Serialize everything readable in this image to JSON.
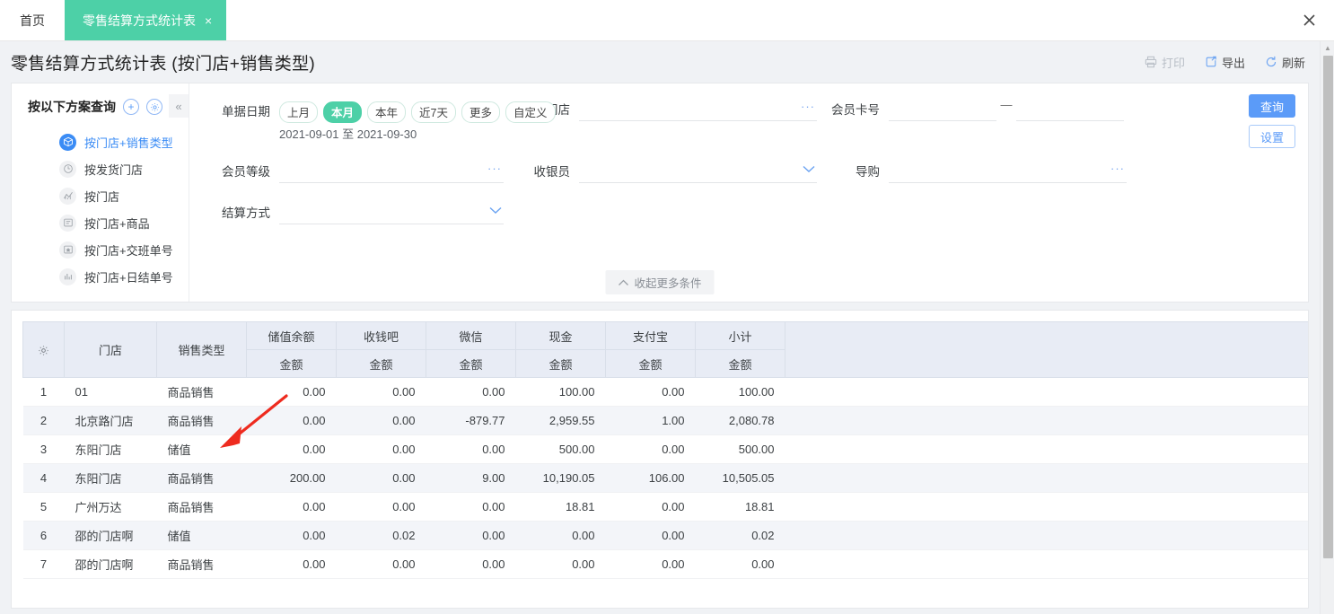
{
  "tabs": {
    "home_label": "首页",
    "active_label": "零售结算方式统计表",
    "close_glyph": "×",
    "window_close_glyph": "✕"
  },
  "header": {
    "title": "零售结算方式统计表 (按门店+销售类型)",
    "actions": [
      {
        "label": "打印",
        "icon": "printer-icon",
        "state": "disabled"
      },
      {
        "label": "导出",
        "icon": "export-icon",
        "state": "enabled"
      },
      {
        "label": "刷新",
        "icon": "refresh-icon",
        "state": "enabled"
      }
    ]
  },
  "scheme": {
    "title": "按以下方案查询",
    "add_glyph": "+",
    "gear_glyph": "⚙",
    "collapse_glyph": "«",
    "items": [
      {
        "label": "按门店+销售类型",
        "icon": "cube-icon",
        "active": true
      },
      {
        "label": "按发货门店",
        "icon": "clock-icon",
        "active": false
      },
      {
        "label": "按门店",
        "icon": "trend-icon",
        "active": false
      },
      {
        "label": "按门店+商品",
        "icon": "list-card-icon",
        "active": false
      },
      {
        "label": "按门店+交班单号",
        "icon": "star-card-icon",
        "active": false
      },
      {
        "label": "按门店+日结单号",
        "icon": "bar-chart-icon",
        "active": false
      }
    ]
  },
  "form": {
    "date": {
      "label": "单据日期",
      "chips": [
        {
          "label": "上月",
          "selected": false
        },
        {
          "label": "本月",
          "selected": true
        },
        {
          "label": "本年",
          "selected": false
        },
        {
          "label": "近7天",
          "selected": false
        },
        {
          "label": "更多",
          "selected": false
        },
        {
          "label": "自定义",
          "selected": false
        }
      ],
      "range_text": "2021-09-01 至 2021-09-30",
      "start": "2021-09-01",
      "end": "2021-09-30"
    },
    "member_level": {
      "label": "会员等级",
      "value": "",
      "suffix": "···"
    },
    "settle_method": {
      "label": "结算方式",
      "value": "",
      "suffix": "chevron-down"
    },
    "ship_store": {
      "label": "发货门店",
      "value": "",
      "suffix": "···"
    },
    "cashier": {
      "label": "收银员",
      "value": "",
      "suffix": "chevron-down"
    },
    "member_card": {
      "label": "会员卡号",
      "from_value": "",
      "to_value": "",
      "separator": "—"
    },
    "guide": {
      "label": "导购",
      "value": "",
      "suffix": "···"
    },
    "buttons": {
      "query": "查询",
      "settings": "设置"
    },
    "collapse_more": {
      "label": "收起更多条件",
      "icon": "chevron-up-icon"
    }
  },
  "table": {
    "settings_icon": "gear-icon",
    "group_headers": [
      "门店",
      "销售类型",
      "储值余额",
      "收钱吧",
      "微信",
      "现金",
      "支付宝",
      "小计"
    ],
    "sub_header_label": "金额",
    "rows": [
      {
        "idx": "1",
        "store": "01",
        "sale_type": "商品销售",
        "stored": "0.00",
        "shouqianba": "0.00",
        "wechat": "0.00",
        "cash": "100.00",
        "alipay": "0.00",
        "subtotal": "100.00",
        "wechat_negative": false
      },
      {
        "idx": "2",
        "store": "北京路门店",
        "sale_type": "商品销售",
        "stored": "0.00",
        "shouqianba": "0.00",
        "wechat": "-879.77",
        "cash": "2,959.55",
        "alipay": "1.00",
        "subtotal": "2,080.78",
        "wechat_negative": true
      },
      {
        "idx": "3",
        "store": "东阳门店",
        "sale_type": "储值",
        "stored": "0.00",
        "shouqianba": "0.00",
        "wechat": "0.00",
        "cash": "500.00",
        "alipay": "0.00",
        "subtotal": "500.00",
        "wechat_negative": false
      },
      {
        "idx": "4",
        "store": "东阳门店",
        "sale_type": "商品销售",
        "stored": "200.00",
        "shouqianba": "0.00",
        "wechat": "9.00",
        "cash": "10,190.05",
        "alipay": "106.00",
        "subtotal": "10,505.05",
        "wechat_negative": false
      },
      {
        "idx": "5",
        "store": "广州万达",
        "sale_type": "商品销售",
        "stored": "0.00",
        "shouqianba": "0.00",
        "wechat": "0.00",
        "cash": "18.81",
        "alipay": "0.00",
        "subtotal": "18.81",
        "wechat_negative": false
      },
      {
        "idx": "6",
        "store": "邵的门店啊",
        "sale_type": "储值",
        "stored": "0.00",
        "shouqianba": "0.02",
        "wechat": "0.00",
        "cash": "0.00",
        "alipay": "0.00",
        "subtotal": "0.02",
        "wechat_negative": false
      },
      {
        "idx": "7",
        "store": "邵的门店啊",
        "sale_type": "商品销售",
        "stored": "0.00",
        "shouqianba": "0.00",
        "wechat": "0.00",
        "cash": "0.00",
        "alipay": "0.00",
        "subtotal": "0.00",
        "wechat_negative": false
      }
    ]
  },
  "colors": {
    "tab_accent": "#4dd0a7",
    "primary_blue": "#5b9bf8",
    "negative_red": "#f5222d",
    "header_bg": "#e8ecf5",
    "page_bg": "#f0f2f5"
  },
  "annotation": {
    "arrow_color": "#ee2b1f",
    "arrow_from": "310,466",
    "arrow_to": "240,518"
  },
  "scrollbar": {
    "up_glyph": "▲"
  }
}
